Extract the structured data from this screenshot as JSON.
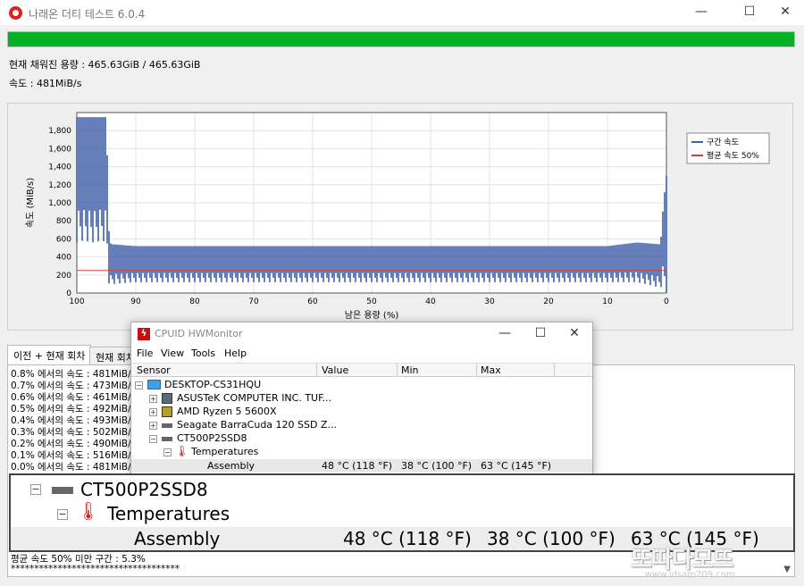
{
  "window": {
    "title": "나래온 더티 테스트 6.0.4",
    "minimize": "—",
    "maximize": "☐",
    "close": "✕"
  },
  "progress": {
    "percent": 100,
    "color": "#06b025"
  },
  "info": {
    "filled": "현재 채워진 용량 : 465.63GiB / 465.63GiB",
    "speed": "속도 : 481MiB/s"
  },
  "chart_data": {
    "type": "line",
    "xlabel": "남은 용량 (%)",
    "ylabel": "속도 (MiB/s)",
    "xlim": [
      100,
      0
    ],
    "ylim": [
      0,
      2000
    ],
    "x_ticks": [
      "100",
      "90",
      "80",
      "70",
      "60",
      "50",
      "40",
      "30",
      "20",
      "10",
      "0"
    ],
    "y_ticks": [
      "0",
      "200",
      "400",
      "600",
      "800",
      "1,000",
      "1,200",
      "1,400",
      "1,600",
      "1,800"
    ],
    "grid": true,
    "legend_position": "right",
    "series": [
      {
        "name": "구간 속도",
        "color": "#3f5fa8",
        "x": [
          100,
          99,
          98,
          97,
          96,
          95,
          94.5,
          94,
          90,
          80,
          70,
          60,
          50,
          40,
          30,
          20,
          10,
          5,
          1,
          0.5,
          0
        ],
        "y_max": [
          1950,
          1950,
          1950,
          1950,
          1950,
          1950,
          560,
          540,
          520,
          520,
          520,
          520,
          520,
          520,
          520,
          520,
          520,
          560,
          540,
          1000,
          1300
        ],
        "y_min": [
          560,
          580,
          570,
          560,
          580,
          570,
          60,
          100,
          120,
          120,
          120,
          120,
          120,
          120,
          120,
          120,
          120,
          120,
          60,
          100,
          0
        ]
      },
      {
        "name": "평균 속도 50%",
        "color": "#d04040",
        "x": [
          100,
          0
        ],
        "y": [
          250,
          250
        ]
      }
    ]
  },
  "tabs": [
    "이전 + 현재 회차",
    "현재 회차"
  ],
  "log": [
    "0.8% 에서의 속도 : 481MiB/s",
    "0.7% 에서의 속도 : 473MiB/s",
    "0.6% 에서의 속도 : 461MiB/s",
    "0.5% 에서의 속도 : 492MiB/s",
    "0.4% 에서의 속도 : 493MiB/s",
    "0.3% 에서의 속도 : 502MiB/s",
    "0.2% 에서의 속도 : 490MiB/s",
    "0.1% 에서의 속도 : 516MiB/s",
    "0.0% 에서의 속도 : 481MiB/s"
  ],
  "log_footer": {
    "avg": "평균 속도 50% 미만 구간 : 5.3%",
    "stars": "************************************"
  },
  "hwmonitor": {
    "title": "CPUID HWMonitor",
    "menu": [
      "File",
      "View",
      "Tools",
      "Help"
    ],
    "columns": [
      "Sensor",
      "Value",
      "Min",
      "Max"
    ],
    "tree": [
      {
        "label": "DESKTOP-CS31HQU",
        "icon": "computer-icon"
      },
      {
        "label": "ASUSTeK COMPUTER INC. TUF...",
        "icon": "motherboard-icon"
      },
      {
        "label": "AMD Ryzen 5 5600X",
        "icon": "cpu-icon"
      },
      {
        "label": "Seagate BarraCuda 120 SSD Z...",
        "icon": "drive-icon"
      },
      {
        "label": "CT500P2SSD8",
        "icon": "drive-icon"
      },
      {
        "label": "Temperatures",
        "icon": "thermometer-icon"
      },
      {
        "label": "Assembly",
        "value": "48 °C  (118 °F)",
        "min": "38 °C  (100 °F)",
        "max": "63 °C  (145 °F)"
      }
    ]
  },
  "zoom": {
    "drive": "CT500P2SSD8",
    "group": "Temperatures",
    "sensor": "Assembly",
    "value": "48 °C  (118 °F)",
    "min": "38 °C  (100 °F)",
    "max": "63 °C  (145 °F)"
  },
  "watermark": {
    "brand": "또따다모뜨",
    "url": "www.idsam209.com"
  }
}
